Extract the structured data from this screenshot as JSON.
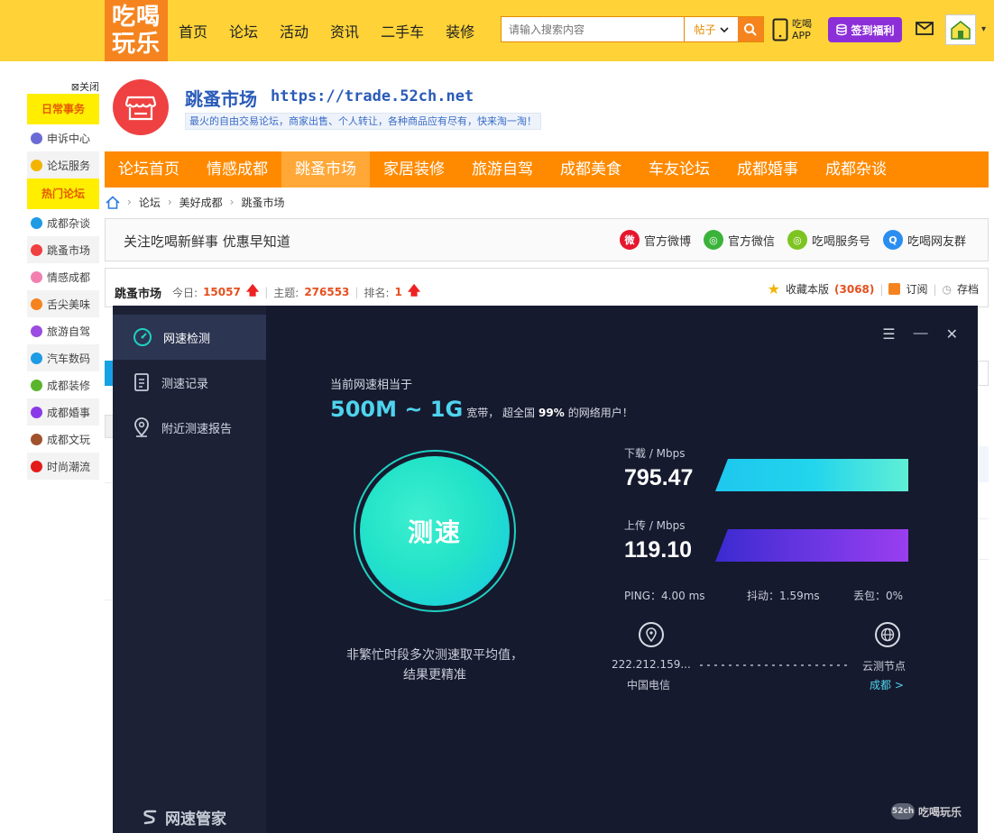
{
  "header": {
    "logo_line1": "吃喝",
    "logo_line2": "玩乐",
    "nav": [
      "首页",
      "论坛",
      "活动",
      "资讯",
      "二手车",
      "装修"
    ],
    "search_placeholder": "请输入搜索内容",
    "search_type": "帖子",
    "app_line1": "吃喝",
    "app_line2": "APP",
    "signin_label": "签到福利",
    "avatar_text": "吃喝玩乐"
  },
  "leftmenu": {
    "close_label": "关闭",
    "section1": "日常事务",
    "items1": [
      "申诉中心",
      "论坛服务"
    ],
    "section2": "热门论坛",
    "items2": [
      "成都杂谈",
      "跳蚤市场",
      "情感成都",
      "舌尖美味",
      "旅游自驾",
      "汽车数码",
      "成都装修",
      "成都婚事",
      "成都文玩",
      "时尚潮流"
    ]
  },
  "forum": {
    "name": "跳蚤市场",
    "url": "https://trade.52ch.net",
    "desc": "最火的自由交易论坛，商家出售、个人转让，各种商品应有尽有，快来淘一淘！",
    "nav": [
      "论坛首页",
      "情感成都",
      "跳蚤市场",
      "家居装修",
      "旅游自驾",
      "成都美食",
      "车友论坛",
      "成都婚事",
      "成都杂谈"
    ],
    "active_nav": "跳蚤市场",
    "breadcrumb": [
      "论坛",
      "美好成都",
      "跳蚤市场"
    ],
    "follow_text": "关注吃喝新鲜事 优惠早知道",
    "follow_links": [
      "官方微博",
      "官方微信",
      "吃喝服务号",
      "吃喝网友群"
    ],
    "stats": {
      "name": "跳蚤市场",
      "today_label": "今日:",
      "today": "15057",
      "topics_label": "主题:",
      "topics": "276553",
      "rank_label": "排名:",
      "rank": "1",
      "fav_label": "收藏本版",
      "fav_count": "(3068)",
      "subscribe": "订阅",
      "archive": "存档"
    }
  },
  "speedtest": {
    "sidebar": [
      "网速检测",
      "测速记录",
      "附近测速报告"
    ],
    "brand": "网速管家",
    "equiv_label": "当前网速相当于",
    "equiv_value": "500M ~ 1G",
    "equiv_mid": "宽带，  超全国",
    "equiv_pct": "99%",
    "equiv_tail": "的网络用户！",
    "button": "测速",
    "tip": "非繁忙时段多次测速取平均值，结果更精准",
    "download_label": "下载 / Mbps",
    "download_value": "795.47",
    "upload_label": "上传 / Mbps",
    "upload_value": "119.10",
    "ping": "PING：4.00 ms",
    "jitter": "抖动：1.59ms",
    "loss": "丢包：0%",
    "ip": "222.212.159...",
    "isp": "中国电信",
    "node_label": "云测节点",
    "node_city": "成都 >"
  },
  "watermark": "吃喝玩乐",
  "colors": {
    "header_bg": "#ffd338",
    "nav_orange": "#ff8a00",
    "panel_bg": "#161a2e",
    "accent_cyan": "#4fd3ee",
    "upload_purple": "#8a3be8"
  }
}
